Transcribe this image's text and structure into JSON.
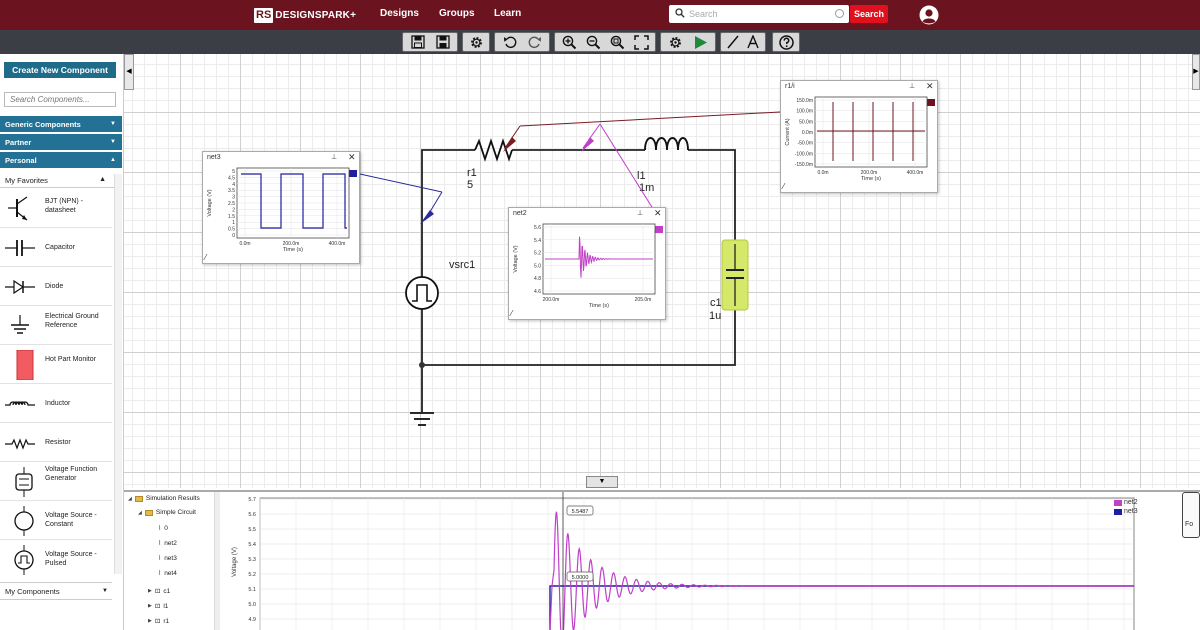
{
  "nav": {
    "logo_rs": "RS",
    "logo_word": "DESIGNSPARK+",
    "links": [
      "Designs",
      "Groups",
      "Learn"
    ],
    "search_placeholder": "Search",
    "search_button": "Search"
  },
  "toolbar": {
    "icons": [
      "save-icon",
      "save-as-icon",
      "settings-icon",
      "undo-icon",
      "redo-icon",
      "zoom-in-icon",
      "zoom-out-icon",
      "zoom-fit-icon",
      "fullscreen-icon",
      "simulation-settings-icon",
      "run-simulation-icon",
      "wire-tool-icon",
      "text-tool-icon",
      "help-icon"
    ]
  },
  "leftpanel": {
    "create_button": "Create New Component",
    "search_placeholder": "Search Components...",
    "categories": [
      "Generic Components",
      "Partner",
      "Personal"
    ],
    "favorites_header": "My Favorites",
    "components": [
      {
        "label": "BJT (NPN) - datasheet",
        "icon": "bjt-npn-icon"
      },
      {
        "label": "Capacitor",
        "icon": "capacitor-icon"
      },
      {
        "label": "Diode",
        "icon": "diode-icon"
      },
      {
        "label": "Electrical Ground Reference",
        "icon": "ground-icon"
      },
      {
        "label": "Hot Part Monitor",
        "icon": "hot-part-monitor-icon"
      },
      {
        "label": "Inductor",
        "icon": "inductor-icon"
      },
      {
        "label": "Resistor",
        "icon": "resistor-icon"
      },
      {
        "label": "Voltage Function Generator",
        "icon": "function-generator-icon"
      },
      {
        "label": "Voltage Source - Constant",
        "icon": "dc-source-icon"
      },
      {
        "label": "Voltage Source - Pulsed",
        "icon": "pulse-source-icon"
      }
    ],
    "my_components": "My Components"
  },
  "schematic": {
    "resistor": {
      "name": "r1",
      "value": "5"
    },
    "inductor": {
      "name": "l1",
      "value": "1m"
    },
    "capacitor": {
      "name": "c1",
      "value": "1u"
    },
    "source": {
      "name": "vsrc1"
    }
  },
  "probes": {
    "net3": {
      "title": "net3",
      "color": "#1e1ea0",
      "ylabel": "Voltage (V)",
      "xlabel": "Time (s)",
      "yticks": [
        "5",
        "4.5",
        "4",
        "3.5",
        "3",
        "2.5",
        "2",
        "1.5",
        "1",
        "0.5",
        "0"
      ],
      "xticks": [
        "0.0m",
        "200.0m",
        "400.0m"
      ]
    },
    "net2": {
      "title": "net2",
      "color": "#c040c8",
      "ylabel": "Voltage (V)",
      "xlabel": "Time (s)",
      "yticks": [
        "5.6",
        "5.4",
        "5.2",
        "5.0",
        "4.8",
        "4.6"
      ],
      "xticks": [
        "200.0m",
        "205.0m"
      ]
    },
    "r1i": {
      "title": "r1/i",
      "color": "#6b1420",
      "ylabel": "Current (A)",
      "xlabel": "Time (s)",
      "yticks": [
        "150.0m",
        "100.0m",
        "50.0m",
        "0.0m",
        "-50.0m",
        "-100.0m",
        "-150.0m"
      ],
      "xticks": [
        "0.0m",
        "200.0m",
        "400.0m"
      ]
    }
  },
  "results": {
    "root": "Simulation Results",
    "circuit": "Simple Circuit",
    "nets": [
      "0",
      "net2",
      "net3",
      "net4"
    ],
    "components": [
      "c1",
      "l1",
      "r1"
    ]
  },
  "bigplot": {
    "ylabel": "Voltage (V)",
    "yticks": [
      "5.7",
      "5.6",
      "5.5",
      "5.4",
      "5.3",
      "5.2",
      "5.1",
      "5.0",
      "4.9",
      "4.8",
      "4.7"
    ],
    "cursor_labels": [
      "5.5487",
      "5.0000"
    ],
    "legend": [
      {
        "name": "net2",
        "color": "#c040c8"
      },
      {
        "name": "net3",
        "color": "#1e1ea0"
      }
    ]
  },
  "side_panel_label": "Fo"
}
